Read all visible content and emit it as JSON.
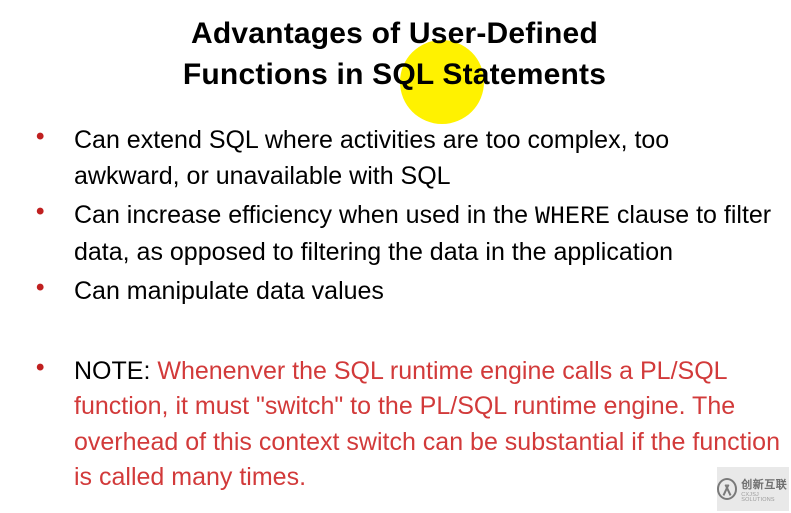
{
  "title_line1": "Advantages of User-Defined",
  "title_line2": "Functions in SQL Statements",
  "bullets": {
    "b1": "Can extend SQL where activities are too complex, too awkward, or unavailable with SQL",
    "b2_pre": "Can increase efficiency when used in the ",
    "b2_code": "WHERE",
    "b2_post": " clause to filter data, as opposed to filtering the data in the application",
    "b3": "Can manipulate data values",
    "b4_prefix": "NOTE: ",
    "b4_body": "Whenenver the SQL runtime engine calls a PL/SQL function, it must \"switch\" to the PL/SQL runtime engine. The overhead of this context switch can be substantial if the function is called many times."
  },
  "watermark": {
    "brand": "创新互联",
    "sub": "CXJSJ SOLUTIONS"
  }
}
